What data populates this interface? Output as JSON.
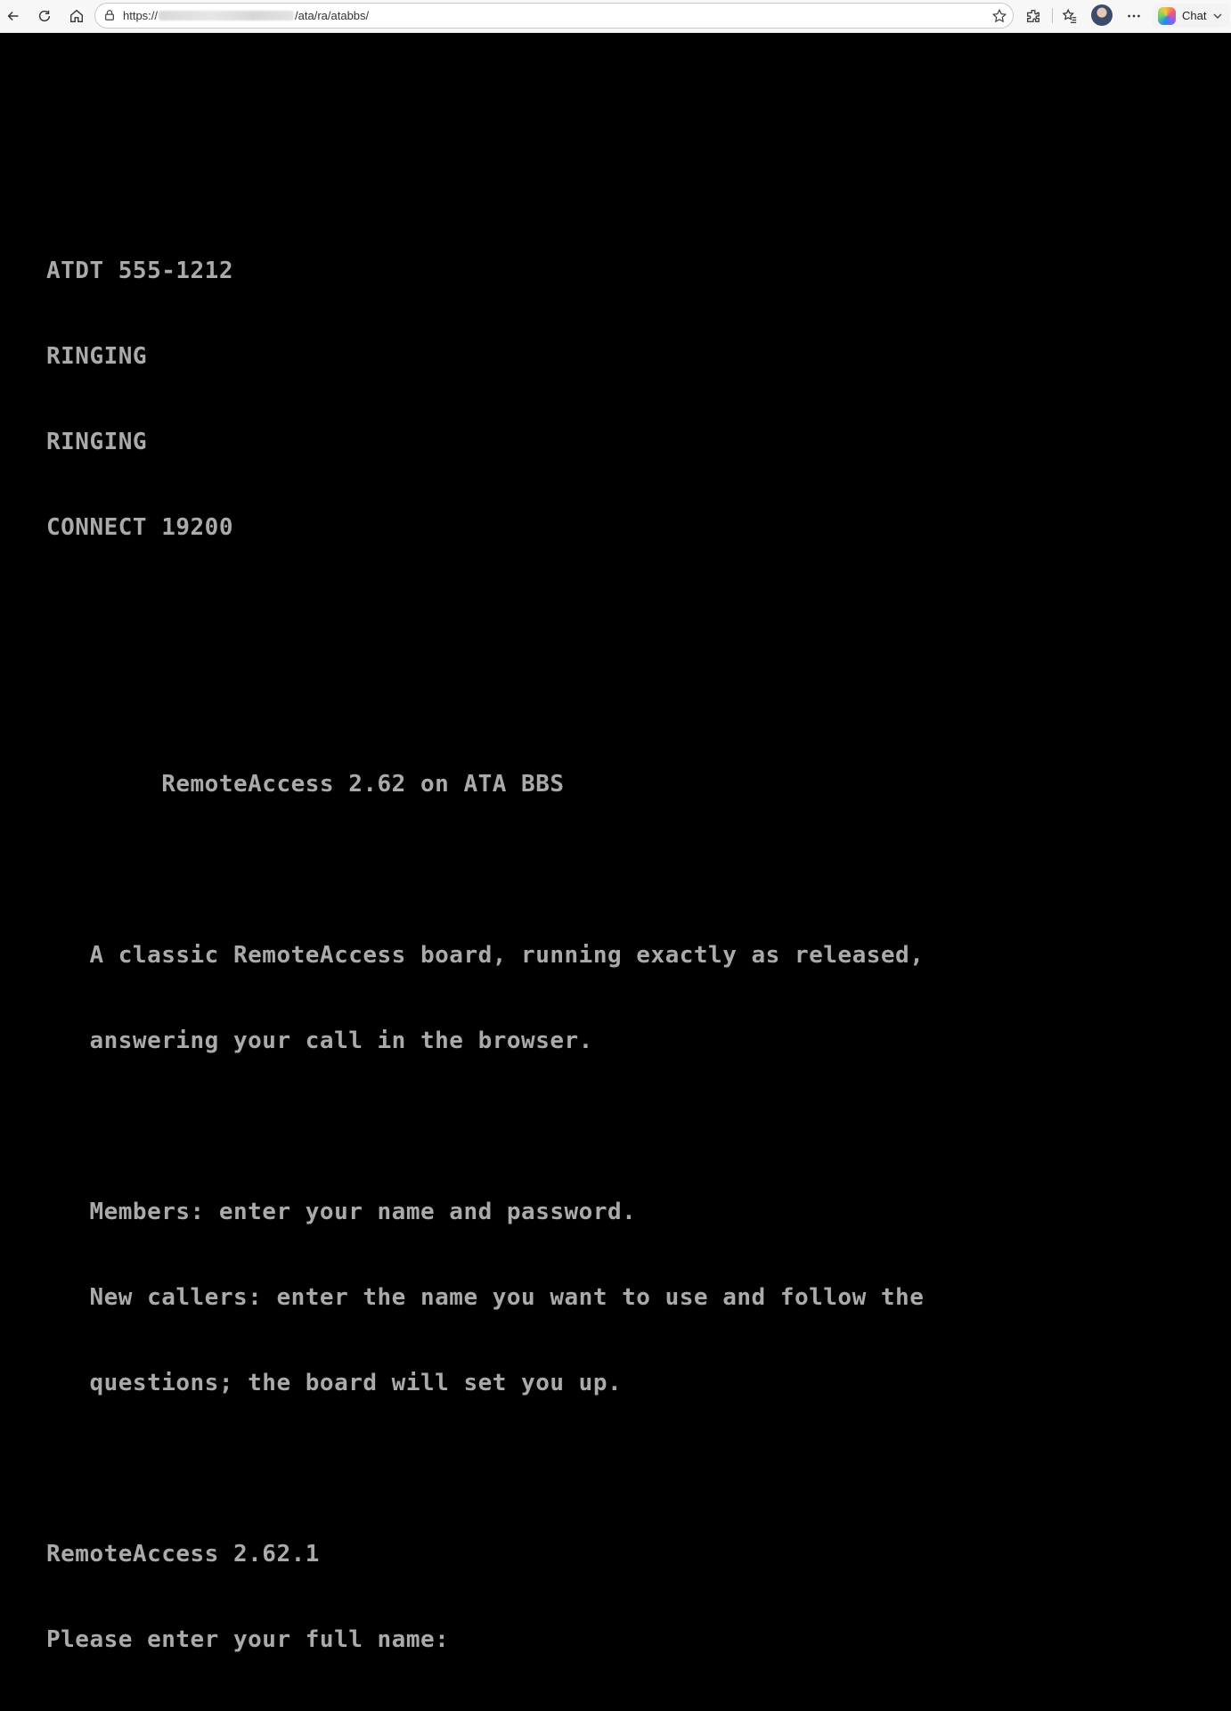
{
  "browser": {
    "url_prefix": "https://",
    "url_path": "/ata/ra/atabbs/",
    "chat_label": "Chat",
    "icons": [
      "back-icon",
      "refresh-icon",
      "home-icon",
      "lock-icon",
      "star-icon",
      "extensions-icon",
      "favorites-icon",
      "more-icon",
      "copilot-icon",
      "chevron-down-icon"
    ]
  },
  "terminal": {
    "lines": [
      "ATDT 555-1212",
      "RINGING",
      "RINGING",
      "CONNECT 19200",
      "",
      "",
      "        RemoteAccess 2.62 on ATA BBS",
      "",
      "   A classic RemoteAccess board, running exactly as released,",
      "   answering your call in the browser.",
      "",
      "   Members: enter your name and password.",
      "   New callers: enter the name you want to use and follow the",
      "   questions; the board will set you up.",
      "",
      "RemoteAccess 2.62.1",
      "Please enter your full name: "
    ],
    "text_color": "#aaaaaa",
    "background_color": "#000000"
  }
}
